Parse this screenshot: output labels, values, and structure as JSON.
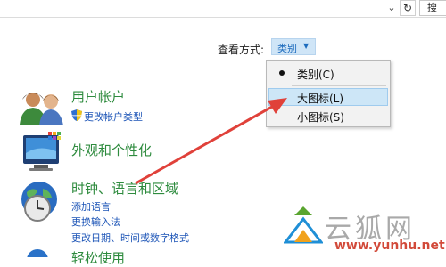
{
  "toolbar": {
    "search_text": "搜",
    "dropdown_icon": "chevron-down-icon",
    "refresh_icon": "refresh-icon"
  },
  "view_by": {
    "label": "查看方式:",
    "selected": "类别"
  },
  "view_menu": {
    "items": [
      {
        "label": "类别(C)",
        "checked": true
      },
      {
        "label": "大图标(L)",
        "highlighted": true
      },
      {
        "label": "小图标(S)"
      }
    ]
  },
  "categories": [
    {
      "title": "用户帐户",
      "links": [
        "更改帐户类型"
      ]
    },
    {
      "title": "外观和个性化",
      "links": []
    },
    {
      "title": "时钟、语言和区域",
      "links": [
        "添加语言",
        "更换输入法",
        "更改日期、时间或数字格式"
      ]
    },
    {
      "title": "轻松使用",
      "links": []
    }
  ],
  "watermark": {
    "text": "云狐网",
    "url": "www.yunhu.net"
  },
  "colors": {
    "category_title": "#2e8b3e",
    "link": "#1d55b7",
    "menu_highlight": "#cde6f7",
    "annotation_arrow": "#e0413a"
  }
}
